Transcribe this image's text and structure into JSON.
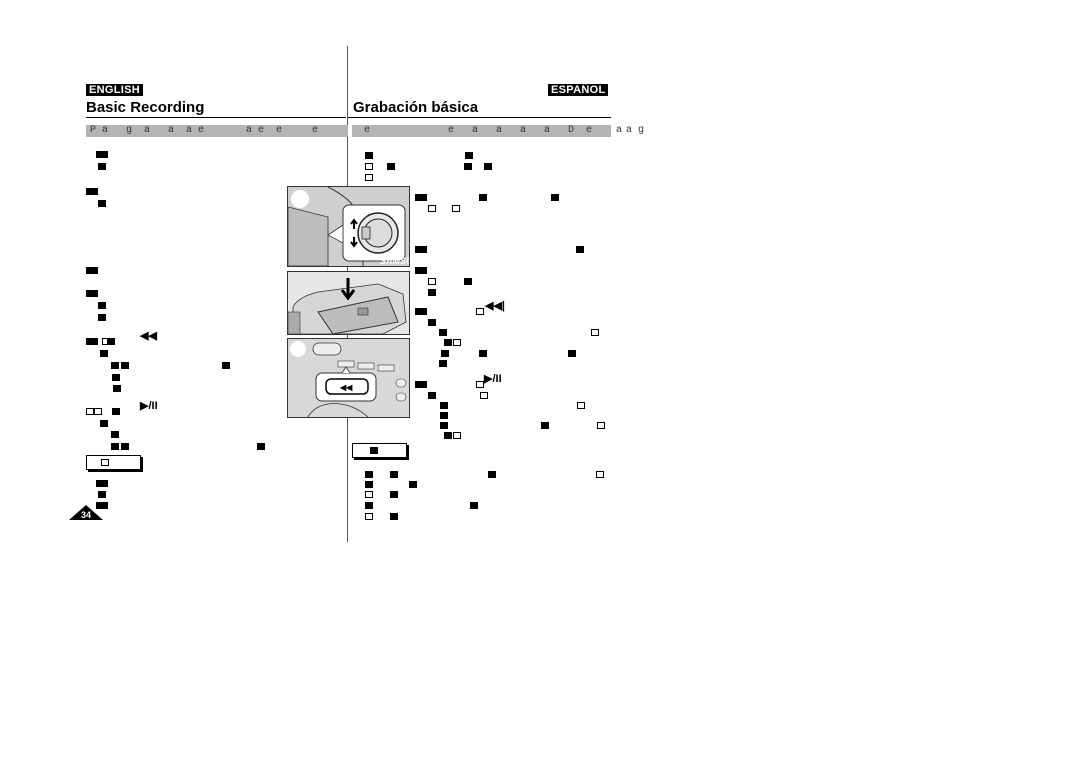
{
  "english": {
    "lang_label": "ENGLISH",
    "title": "Basic Recording",
    "band_text": "P a   g  a   a  a e       a e  e     e"
  },
  "espanol": {
    "lang_label": "ESPAÑOL",
    "title": "Grabación básica",
    "band_text": "  e             e   a   a   a   a   D  e    a",
    "band_overflow": "a g"
  },
  "symbols": {
    "rewind": "◀◀",
    "play_pause": "▶/II",
    "rewind_small": "◀◀|",
    "play_pause_small": "▶/II"
  },
  "page_number": "34",
  "illustrations": [
    {
      "name": "mode-dial-illustration",
      "label": "SAMSUNG"
    },
    {
      "name": "lcd-panel-illustration"
    },
    {
      "name": "rewind-button-illustration",
      "button_symbol": "◀◀"
    }
  ]
}
